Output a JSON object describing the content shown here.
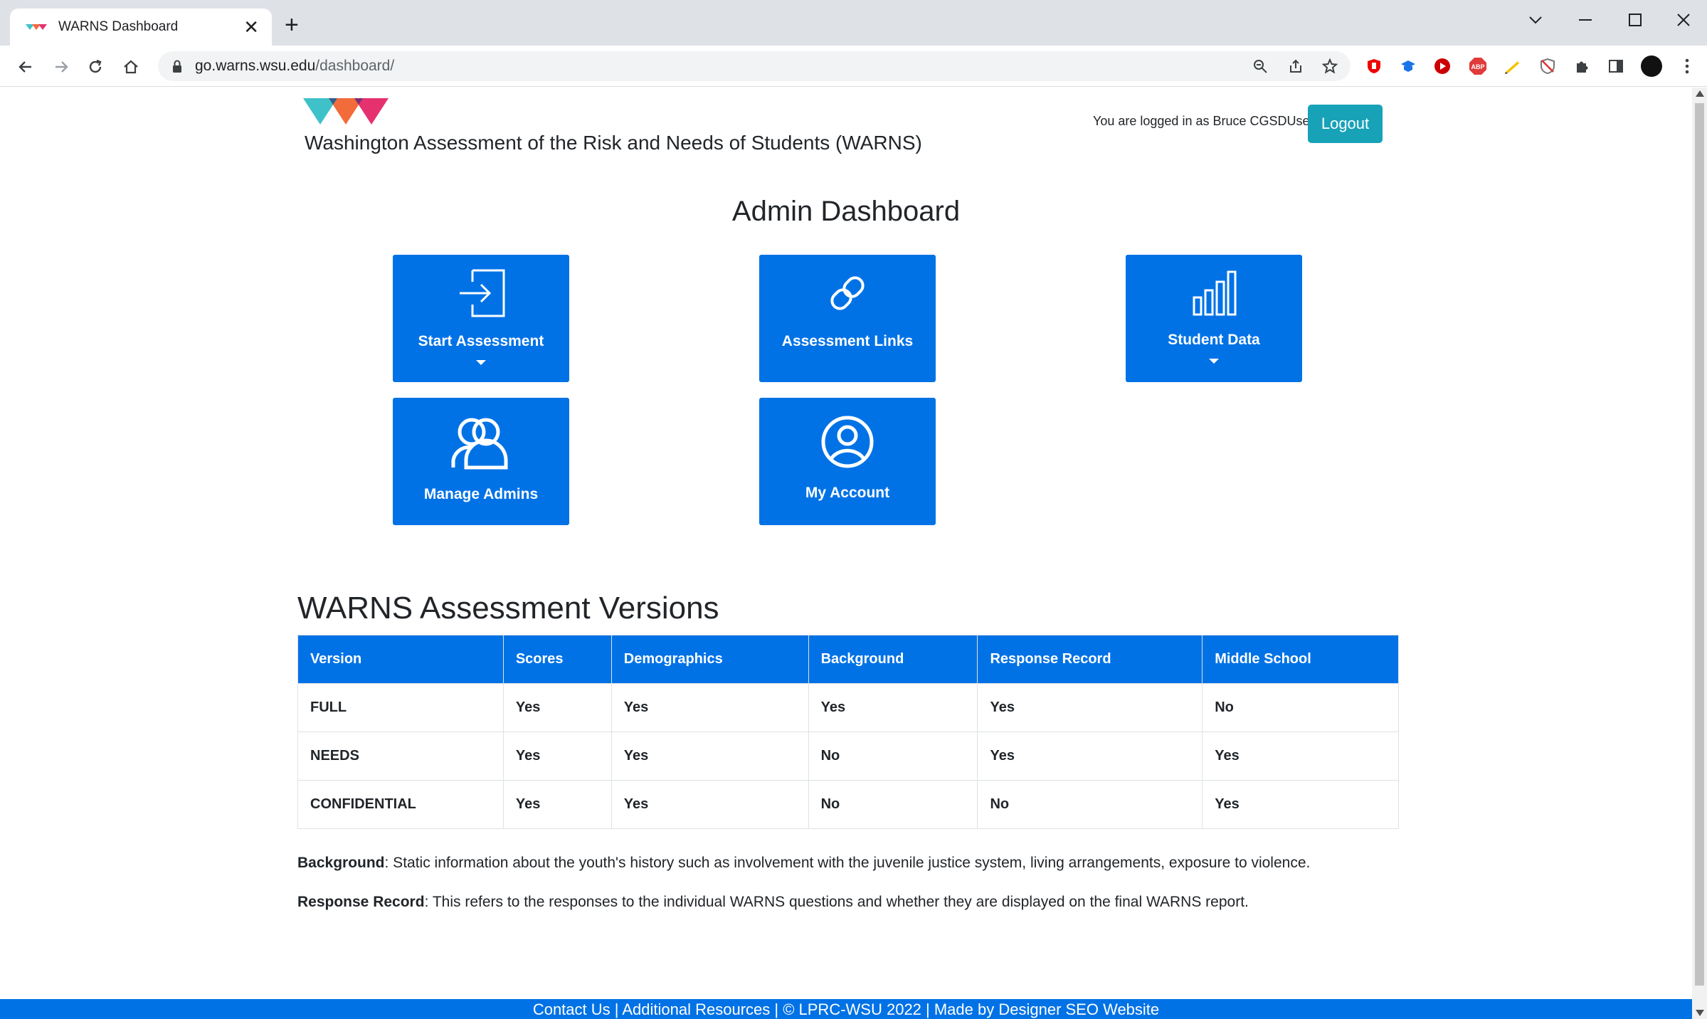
{
  "browser": {
    "tab_title": "WARNS Dashboard",
    "tab_close": "✕",
    "new_tab": "+",
    "url_host": "go.warns.wsu.edu",
    "url_path": "/dashboard/"
  },
  "header": {
    "site_title": "Washington Assessment of the Risk and Needs of Students (WARNS)",
    "login_text": "You are logged in as Bruce CGSDUser",
    "logout_label": "Logout"
  },
  "dashboard": {
    "title": "Admin Dashboard",
    "tiles": [
      {
        "label": "Start Assessment",
        "icon": "sign-in-icon",
        "has_dropdown": true
      },
      {
        "label": "Assessment Links",
        "icon": "link-icon",
        "has_dropdown": false
      },
      {
        "label": "Student Data",
        "icon": "bar-chart-icon",
        "has_dropdown": true
      },
      {
        "label": "Manage Admins",
        "icon": "people-icon",
        "has_dropdown": false
      },
      {
        "label": "My Account",
        "icon": "user-circle-icon",
        "has_dropdown": false
      }
    ]
  },
  "versions": {
    "title": "WARNS Assessment Versions",
    "headers": [
      "Version",
      "Scores",
      "Demographics",
      "Background",
      "Response Record",
      "Middle School"
    ],
    "rows": [
      [
        "FULL",
        "Yes",
        "Yes",
        "Yes",
        "Yes",
        "No"
      ],
      [
        "NEEDS",
        "Yes",
        "Yes",
        "No",
        "Yes",
        "Yes"
      ],
      [
        "CONFIDENTIAL",
        "Yes",
        "Yes",
        "No",
        "No",
        "Yes"
      ]
    ]
  },
  "notes": {
    "background_term": "Background",
    "background_text": ": Static information about the youth's history such as involvement with the juvenile justice system, living arrangements, exposure to violence.",
    "response_term": "Response Record",
    "response_text": ": This refers to the responses to the individual WARNS questions and whether they are displayed on the final WARNS report."
  },
  "footer": {
    "text": "Contact Us | Additional Resources | © LPRC-WSU 2022 | Made by Designer SEO Website"
  },
  "colors": {
    "tile_blue": "#0072e6",
    "logout_teal": "#17a2b8"
  }
}
